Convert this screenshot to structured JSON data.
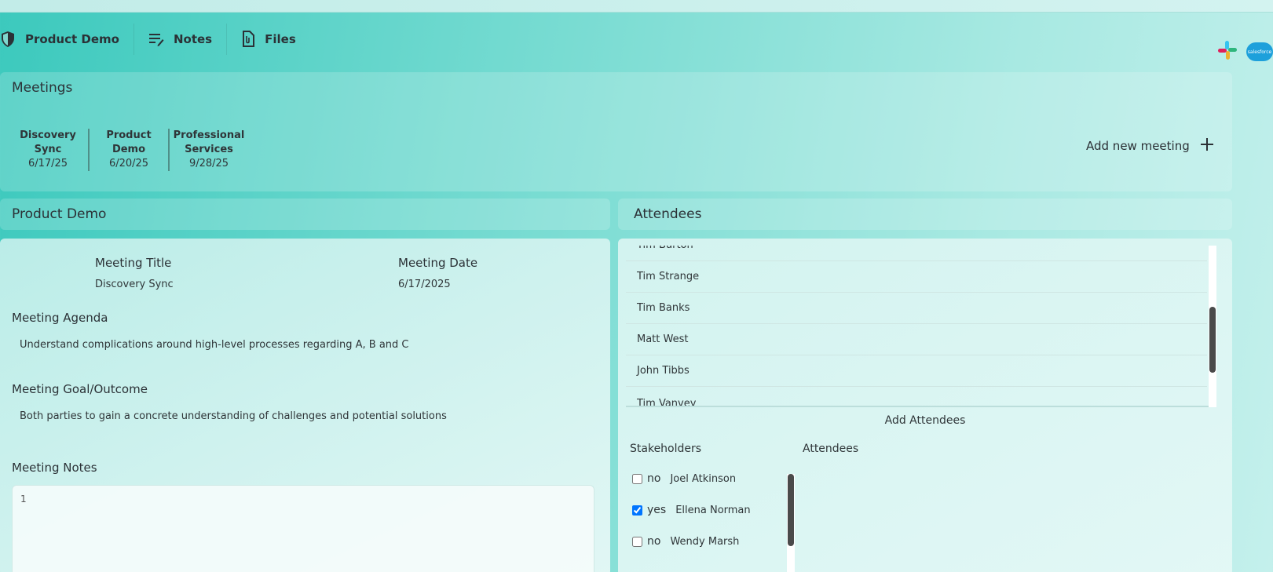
{
  "nav": {
    "items": [
      {
        "label": "Product Demo",
        "icon": "shield-icon"
      },
      {
        "label": "Notes",
        "icon": "notes-icon"
      },
      {
        "label": "Files",
        "icon": "file-icon"
      }
    ],
    "integrations": [
      "slack-icon",
      "salesforce-icon"
    ],
    "salesforce_text": "salesforce"
  },
  "meetings": {
    "title": "Meetings",
    "tabs": [
      {
        "title_line1": "Discovery",
        "title_line2": "Sync",
        "date": "6/17/25"
      },
      {
        "title_line1": "Product",
        "title_line2": "Demo",
        "date": "6/20/25"
      },
      {
        "title_line1": "Professional",
        "title_line2": "Services",
        "date": "9/28/25"
      }
    ],
    "add_label": "Add new meeting"
  },
  "detail": {
    "header": "Product Demo",
    "meeting_title_label": "Meeting Title",
    "meeting_title_value": "Discovery Sync",
    "meeting_date_label": "Meeting Date",
    "meeting_date_value": "6/17/2025",
    "agenda_label": "Meeting Agenda",
    "agenda_value": "Understand complications around high-level processes regarding A, B and C",
    "goal_label": "Meeting Goal/Outcome",
    "goal_value": "Both parties to gain a concrete understanding of challenges and potential solutions",
    "notes_label": "Meeting Notes",
    "notes_value": "1"
  },
  "attendees": {
    "header": "Attendees",
    "list": [
      "Tim Burton",
      "Tim Strange",
      "Tim Banks",
      "Matt West",
      "John Tibbs",
      "Tim Vanvey"
    ],
    "add_title": "Add Attendees",
    "stakeholders_title": "Stakeholders",
    "attendees_title": "Attendees",
    "stakeholders": [
      {
        "name": "Joel Atkinson",
        "checked": false,
        "state": "no"
      },
      {
        "name": "Ellena Norman",
        "checked": true,
        "state": "yes"
      },
      {
        "name": "Wendy Marsh",
        "checked": false,
        "state": "no"
      }
    ]
  }
}
